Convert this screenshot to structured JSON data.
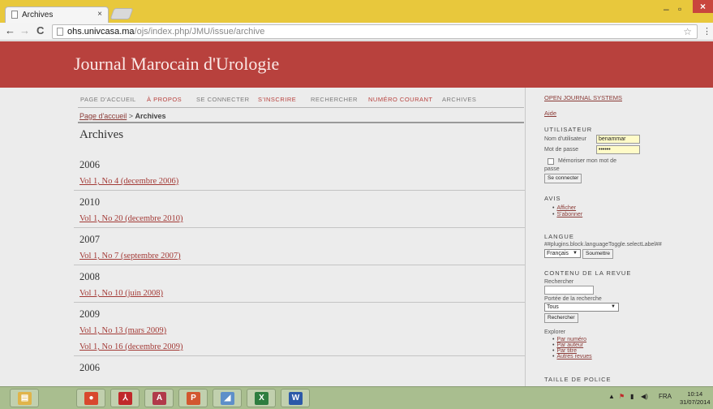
{
  "browser": {
    "tab_title": "Archives",
    "tab_close": "×",
    "url_host": "ohs.univcasa.ma",
    "url_path": "/ojs/index.php/JMU/issue/archive",
    "back": "←",
    "forward": "→",
    "reload": "C",
    "minimize": "–",
    "maximize": "▫",
    "close": "×",
    "star": "☆",
    "menu": "⋮"
  },
  "journal": {
    "title": "Journal Marocain d'Urologie"
  },
  "nav": {
    "items": [
      {
        "label": "PAGE D'ACCUEIL",
        "accent": false
      },
      {
        "label": "À PROPOS",
        "accent": true
      },
      {
        "label": "SE CONNECTER",
        "accent": false
      },
      {
        "label": "S'INSCRIRE",
        "accent": true
      },
      {
        "label": "RECHERCHER",
        "accent": false
      },
      {
        "label": "NUMÉRO COURANT",
        "accent": true
      },
      {
        "label": "ARCHIVES",
        "accent": false
      }
    ]
  },
  "breadcrumb": {
    "home": "Page d'accueil",
    "separator": " > ",
    "current": "Archives"
  },
  "page_title": "Archives",
  "archive": [
    {
      "year": "2006",
      "issues": [
        "Vol 1, No 4 (decembre 2006)"
      ]
    },
    {
      "year": "2010",
      "issues": [
        "Vol 1, No 20 (decembre 2010)"
      ]
    },
    {
      "year": "2007",
      "issues": [
        "Vol 1, No 7 (septembre 2007)"
      ]
    },
    {
      "year": "2008",
      "issues": [
        "Vol 1, No 10 (juin 2008)"
      ]
    },
    {
      "year": "2009",
      "issues": [
        "Vol 1, No 13 (mars 2009)",
        "Vol 1, No 16 (decembre 2009)"
      ]
    },
    {
      "year": "2006",
      "issues": []
    }
  ],
  "sidebar": {
    "ojs_link": "OPEN JOURNAL SYSTEMS",
    "help_link": "Aide",
    "user": {
      "heading": "UTILISATEUR",
      "username_label": "Nom d'utilisateur",
      "username_value": "benammar",
      "password_label": "Mot de passe",
      "password_value": "••••••",
      "remember_label": "Mémoriser mon mot de",
      "remember_label_2": "passe",
      "login_button": "Se connecter"
    },
    "notices": {
      "heading": "AVIS",
      "items": [
        "Afficher",
        "S'abonner"
      ]
    },
    "language": {
      "heading": "LANGUE",
      "label": "##plugins.block.languageToggle.selectLabel##",
      "selected": "Français",
      "submit": "Soumettre"
    },
    "content": {
      "heading": "CONTENU DE LA REVUE",
      "search_label": "Rechercher",
      "scope_label": "Portée de la recherche",
      "scope_value": "Tous",
      "search_button": "Rechercher",
      "browse_label": "Explorer",
      "browse_items": [
        "Par numéro",
        "Par auteur",
        "Par titre",
        "Autres revues"
      ]
    },
    "font_size": {
      "heading": "TAILLE DE POLICE"
    }
  },
  "taskbar": {
    "apps": [
      {
        "name": "file-explorer-icon",
        "glyph": "▤",
        "color": "#e0b44a"
      },
      {
        "name": "chrome-icon",
        "glyph": "●",
        "color": "#d8482e"
      },
      {
        "name": "acrobat-icon",
        "glyph": "⅄",
        "color": "#c0282a"
      },
      {
        "name": "access-icon",
        "glyph": "A",
        "color": "#b13a4a"
      },
      {
        "name": "powerpoint-icon",
        "glyph": "P",
        "color": "#d2572f"
      },
      {
        "name": "paint-icon",
        "glyph": "◢",
        "color": "#5e8fc9"
      },
      {
        "name": "excel-icon",
        "glyph": "X",
        "color": "#2e7d3f"
      },
      {
        "name": "word-icon",
        "glyph": "W",
        "color": "#2c59a8"
      }
    ],
    "language": "FRA",
    "time": "10:14",
    "date": "31/07/2014"
  }
}
